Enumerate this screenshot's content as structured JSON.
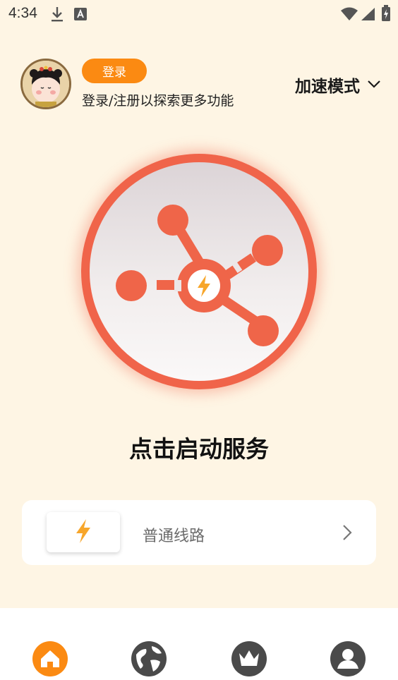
{
  "status_bar": {
    "time": "4:34"
  },
  "header": {
    "login_label": "登录",
    "login_hint": "登录/注册以探索更多功能",
    "mode_label": "加速模式"
  },
  "main": {
    "start_label": "点击启动服务"
  },
  "route": {
    "label": "普通线路"
  },
  "colors": {
    "background": "#FEF5E4",
    "accent": "#F0644A",
    "login_button": "#FB8A12",
    "lightning": "#F7A62B",
    "nav_active": "#FB8A12",
    "nav_inactive": "#4a4a4a"
  },
  "icons": {
    "status": [
      "download-icon",
      "text-a-icon",
      "wifi-icon",
      "signal-icon",
      "battery-icon"
    ],
    "nav": [
      "home-icon",
      "globe-icon",
      "crown-icon",
      "profile-icon"
    ]
  }
}
